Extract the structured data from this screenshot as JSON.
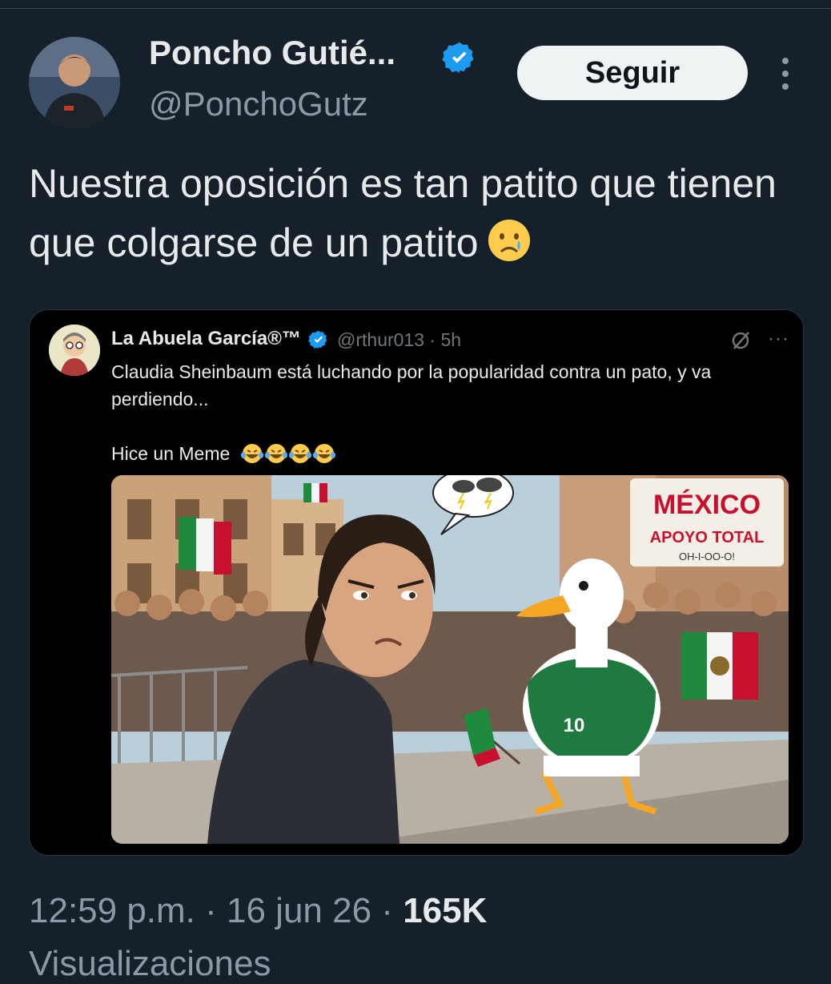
{
  "tweet": {
    "author": {
      "display_name": "Poncho Gutié...",
      "handle": "@PonchoGutz"
    },
    "follow_label": "Seguir",
    "text": "Nuestra oposición es tan patito que tienen que colgarse de un patito",
    "text_emoji_icon": "crying-face-emoji",
    "verified_color": "#1d9bf0"
  },
  "quoted_tweet": {
    "author": {
      "display_name": "La Abuela García®™",
      "handle": "@rthur013 · 5h"
    },
    "text_line1": "Claudia Sheinbaum está luchando por la popularidad contra un pato, y va perdiendo...",
    "text_line2": "Hice un Meme",
    "emojis": [
      "joy-emoji",
      "joy-emoji",
      "joy-emoji",
      "joy-emoji"
    ],
    "meme": {
      "banner_title": "MÉXICO",
      "banner_sub": "APOYO TOTAL",
      "banner_chant": "OH-I-OO-O!",
      "jersey_number": "10"
    }
  },
  "footer": {
    "time": "12:59 p.m.",
    "date": "16 jun 26",
    "separator": " · ",
    "views_count": "165K",
    "views_label": "Visualizaciones"
  }
}
